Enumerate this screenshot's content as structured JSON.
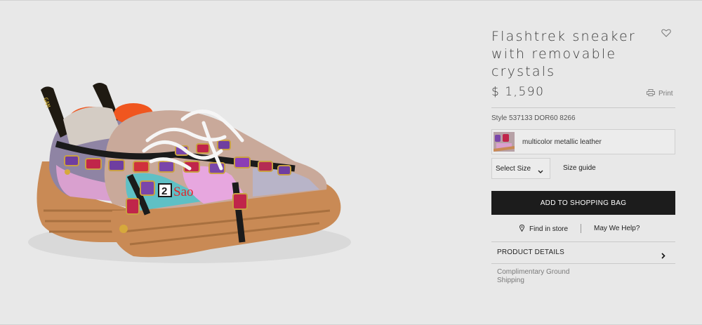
{
  "product": {
    "title": "Flashtrek sneaker with removable crystals",
    "price": "$ 1,590",
    "style": "Style 537133 DOR60 8266",
    "color_label": "multicolor metallic leather"
  },
  "actions": {
    "print_label": "Print",
    "select_size_label": "Select Size",
    "size_guide_label": "Size guide",
    "add_to_bag_label": "ADD TO SHOPPING BAG",
    "find_in_store_label": "Find in store",
    "help_label": "May We Help?"
  },
  "details": {
    "label": "PRODUCT DETAILS",
    "shipping": "Complimentary Ground Shipping"
  },
  "image": {
    "heel_tab_text": "GAM",
    "watermark_number": "2",
    "watermark_text": "Sao"
  },
  "icons": {
    "wishlist": "heart-icon",
    "print": "printer-icon",
    "select": "chevron-down-icon",
    "store": "location-pin-icon",
    "details": "chevron-right-icon"
  },
  "colors": {
    "background": "#e8e8e8",
    "button": "#1c1c1c",
    "sole": "#c98a55",
    "watermark": "#e0262c"
  }
}
